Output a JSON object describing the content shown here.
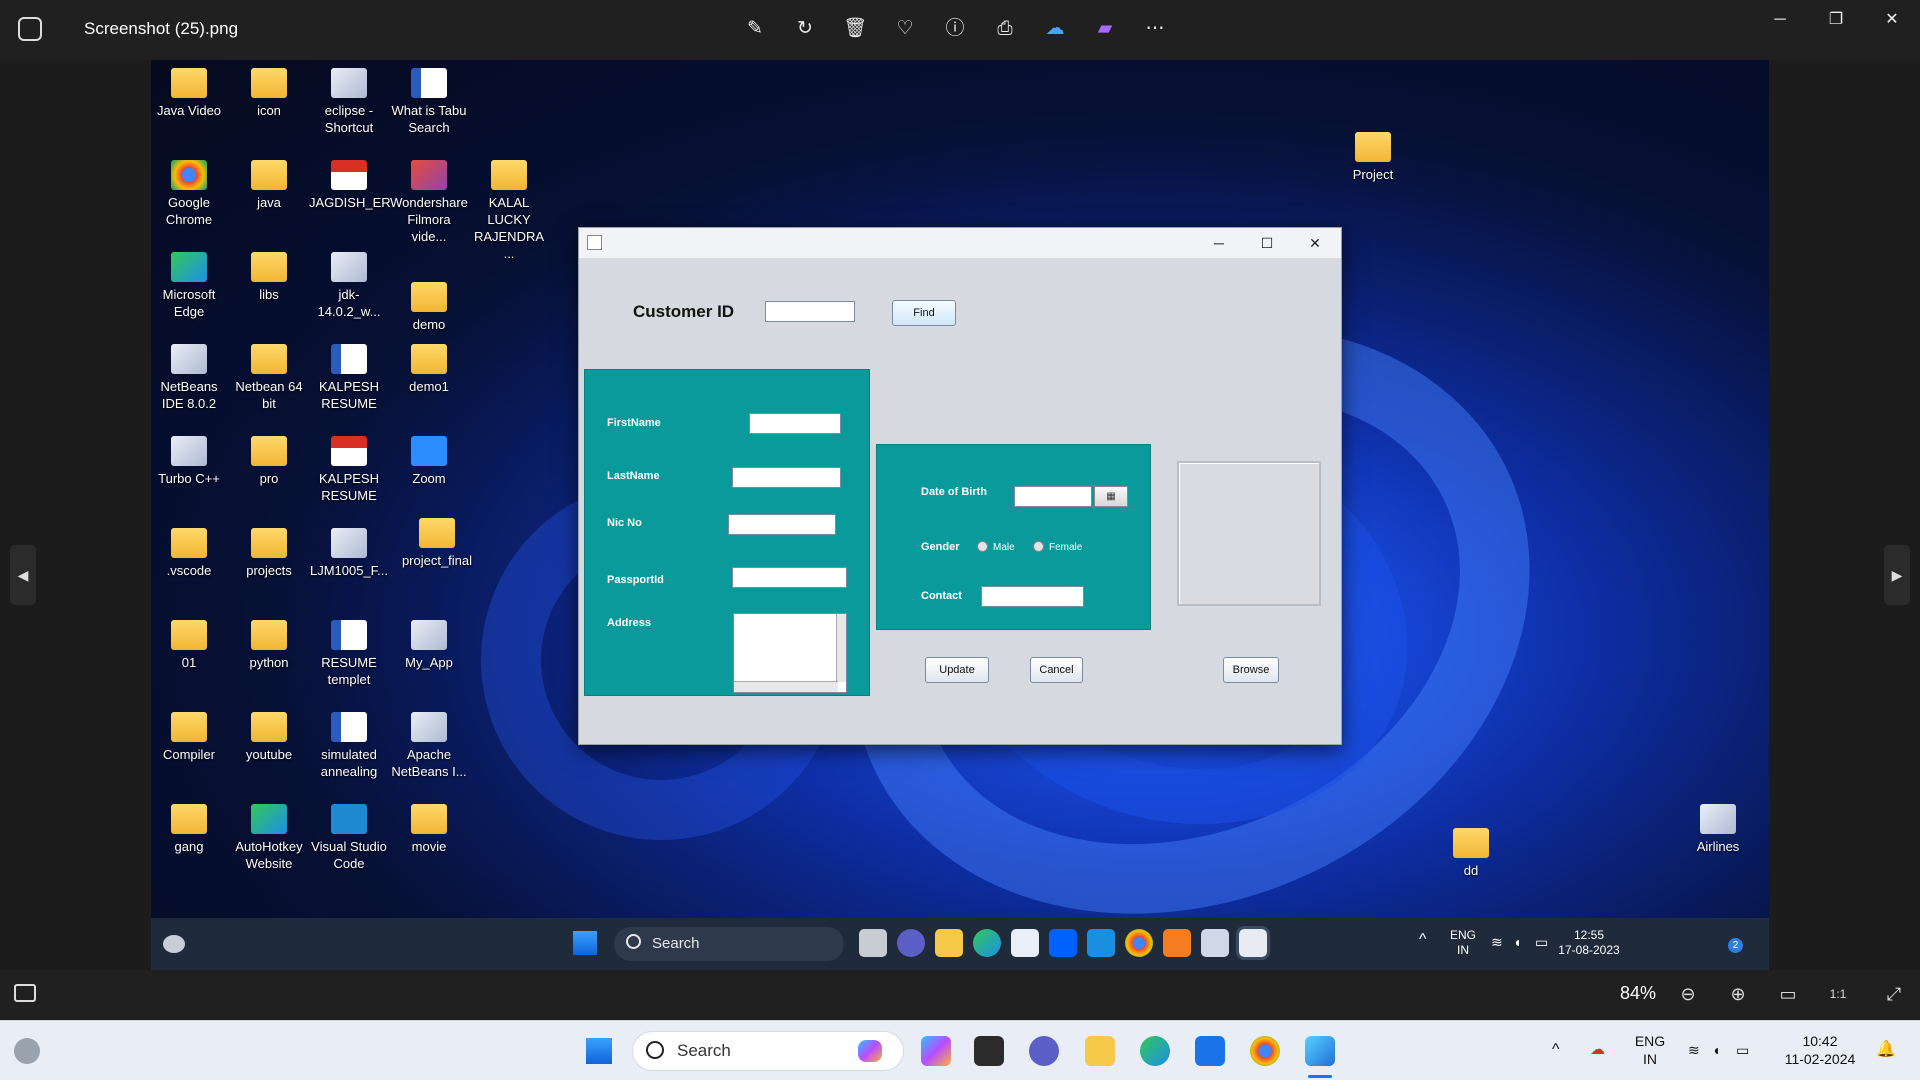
{
  "viewer": {
    "filename": "Screenshot (25).png",
    "zoom": "84%",
    "toolbar_icons": [
      "edit-icon",
      "rotate-icon",
      "delete-icon",
      "favorite-icon",
      "info-icon",
      "print-icon",
      "onedrive-icon",
      "clipchamp-icon",
      "more-icon"
    ],
    "window_controls": {
      "minimize": "─",
      "restore": "❐",
      "close": "✕"
    },
    "prev": "◀",
    "next": "▶",
    "bottom_icons": {
      "zoom_out": "⊖",
      "zoom_in": "⊕",
      "fit": "▭",
      "actual": "1:1",
      "fullscreen": "⤢"
    }
  },
  "desktop": {
    "icons": [
      {
        "label": "Java Video",
        "kind": "folder"
      },
      {
        "label": "icon",
        "kind": "folder"
      },
      {
        "label": "eclipse - Shortcut",
        "kind": "app"
      },
      {
        "label": "What is Tabu Search",
        "kind": "word"
      },
      {
        "label": "Google Chrome",
        "kind": "chrome"
      },
      {
        "label": "java",
        "kind": "folder"
      },
      {
        "label": "JAGDISH_ER",
        "kind": "pdf"
      },
      {
        "label": "Wondershare Filmora vide...",
        "kind": "app"
      },
      {
        "label": "KALAL LUCKY RAJENDRA ...",
        "kind": "folder"
      },
      {
        "label": "Microsoft Edge",
        "kind": "edge"
      },
      {
        "label": "libs",
        "kind": "folder"
      },
      {
        "label": "jdk-14.0.2_w...",
        "kind": "app"
      },
      {
        "label": "demo",
        "kind": "folder"
      },
      {
        "label": "NetBeans IDE 8.0.2",
        "kind": "app"
      },
      {
        "label": "Netbean 64 bit",
        "kind": "folder"
      },
      {
        "label": "KALPESH RESUME",
        "kind": "word"
      },
      {
        "label": "demo1",
        "kind": "folder"
      },
      {
        "label": "Turbo C++",
        "kind": "app"
      },
      {
        "label": "pro",
        "kind": "folder"
      },
      {
        "label": "KALPESH RESUME",
        "kind": "pdf"
      },
      {
        "label": "Zoom",
        "kind": "zoom"
      },
      {
        "label": ".vscode",
        "kind": "folder"
      },
      {
        "label": "projects",
        "kind": "folder"
      },
      {
        "label": "LJM1005_F...",
        "kind": "app"
      },
      {
        "label": "project_final",
        "kind": "folder"
      },
      {
        "label": "01",
        "kind": "folder"
      },
      {
        "label": "python",
        "kind": "folder"
      },
      {
        "label": "RESUME templet",
        "kind": "word"
      },
      {
        "label": "My_App",
        "kind": "app"
      },
      {
        "label": "Compiler",
        "kind": "folder"
      },
      {
        "label": "youtube",
        "kind": "folder"
      },
      {
        "label": "simulated annealing",
        "kind": "word"
      },
      {
        "label": "Apache NetBeans I...",
        "kind": "app"
      },
      {
        "label": "gang",
        "kind": "folder"
      },
      {
        "label": "AutoHotkey Website",
        "kind": "edge"
      },
      {
        "label": "Visual Studio Code",
        "kind": "vscode"
      },
      {
        "label": "movie",
        "kind": "folder"
      },
      {
        "label": "Project",
        "kind": "folder"
      },
      {
        "label": "dd",
        "kind": "folder"
      },
      {
        "label": "Airlines",
        "kind": "app"
      }
    ]
  },
  "form": {
    "customer_id_label": "Customer ID",
    "customer_id_value": "",
    "find_button": "Find",
    "first_name_label": "FirstName",
    "last_name_label": "LastName",
    "nic_label": "Nic No",
    "passport_label": "PassportId",
    "address_label": "Address",
    "dob_label": "Date of Birth",
    "gender_label": "Gender",
    "male_label": "Male",
    "female_label": "Female",
    "contact_label": "Contact",
    "update_button": "Update",
    "cancel_button": "Cancel",
    "browse_button": "Browse",
    "colors": {
      "panel": "#0b9a9c",
      "window_bg": "#d6d9df"
    }
  },
  "inner_taskbar": {
    "search": "Search",
    "lang": "ENG",
    "region": "IN",
    "time": "12:55",
    "date": "17-08-2023",
    "notifications": "2"
  },
  "outer_taskbar": {
    "search": "Search",
    "lang": "ENG",
    "region": "IN",
    "time": "10:42",
    "date": "11-02-2024"
  }
}
